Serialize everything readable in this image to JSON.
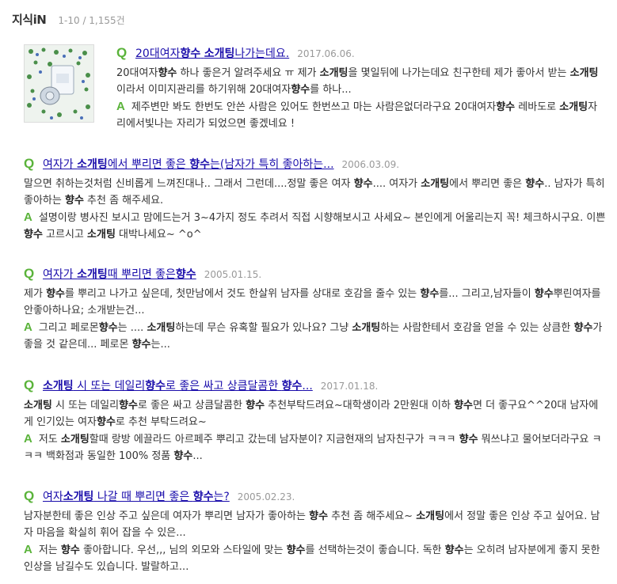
{
  "section": {
    "title": "지식iN",
    "count": "1-10 / 1,155건"
  },
  "icons": {
    "question": "Q",
    "answer": "A",
    "question_icon_color": "#5ab33a",
    "link_color": "#1a0dab"
  },
  "results": [
    {
      "title": "20대여자향수 소개팅나가는데요.",
      "date": "2017.06.06.",
      "question": "20대여자향수 하나 좋은거 알려주세요 ㅠ 제가 소개팅을 몇일뒤에 나가는데요 친구한테 제가 좋아서 받는 소개팅이라서 이미지관리를 하기위해 20대여자향수를 하나...",
      "answer": "제주변만 봐도 한번도 안쓴 사람은 있어도 한번쓰고 마는 사람은없더라구요 20대여자향수 레바도로 소개팅자리에서빛나는 자리가 되었으면 좋겠네요 !",
      "has_thumbnail": true
    },
    {
      "title": "여자가 소개팅에서 뿌리면 좋은 향수는(남자가 특히 좋아하는...",
      "date": "2006.03.09.",
      "question": "말으면 취하는것처럼 신비롭게 느껴진대나.. 그래서 그런데....정말 좋은 여자 향수.... 여자가 소개팅에서 뿌리면 좋은 향수.. 남자가 특히 좋아하는 향수 추천 좀 해주세요.",
      "answer": "설명이랑 병사진 보시고 맘에드는거 3~4가지 정도 추려서 직접 시향해보시고 사세요~ 본인에게 어울리는지 꼭! 체크하시구요. 이쁜 향수 고르시고 소개팅 대박나세요~ ^o^"
    },
    {
      "title": "여자가 소개팅때 뿌리면 좋은향수",
      "date": "2005.01.15.",
      "question": "제가 향수를 뿌리고 나가고 싶은데, 첫만남에서 것도 한살위 남자를 상대로 호감을 줄수 있는 향수를... 그리고,남자들이 향수뿌린여자를 안좋아하나요; 소개받는건...",
      "answer": "그리고 페로몬향수는 .... 소개팅하는데 무슨 유혹할 필요가 있나요? 그냥 소개팅하는 사람한테서 호감을 얻을 수 있는 상큼한 향수가 좋을 것 같은데... 페로몬 향수는..."
    },
    {
      "title": "소개팅 시 또는 데일리향수로 좋은 싸고 상큼달콤한 향수...",
      "date": "2017.01.18.",
      "question": "소개팅 시 또는 데일리향수로 좋은 싸고 상큼달콤한 향수 추천부탁드려요~대학생이라 2만원대 이하 향수면 더 좋구요^^20대 남자에게 인기있는 여자향수로 추천 부탁드려요~",
      "answer": "저도 소개팅할때 랑방 에끌라드 아르페주 뿌리고 갔는데 남자분이? 지금현재의 남자친구가 ㅋㅋㅋ 향수 뭐쓰냐고 물어보더라구요 ㅋㅋㅋ 백화점과 동일한 100% 정품 향수..."
    },
    {
      "title": "여자소개팅 나갈 때 뿌리면 좋은 향수는?",
      "date": "2005.02.23.",
      "question": "남자분한테 좋은 인상 주고 싶은데 여자가 뿌리면 남자가 좋아하는 향수 추천 좀 해주세요~ 소개팅에서 정말 좋은 인상 주고 싶어요. 남자 마음을 확실히 휘어 잡을 수 있은...",
      "answer": "저는 향수 좋아합니다. 우선,,, 님의 외모와 스타일에 맞는 향수를 선택하는것이 좋습니다. 독한 향수는 오히려 남자분에게 좋지 못한 인상을 남길수도 있습니다. 발랄하고..."
    }
  ]
}
